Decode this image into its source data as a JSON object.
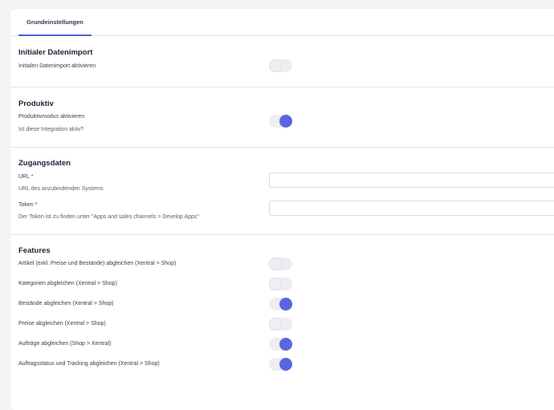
{
  "tabs": [
    {
      "label": "Grundeinstellungen",
      "active": true
    }
  ],
  "sections": {
    "initial_import": {
      "heading": "Initialer Datenimport",
      "toggle_label": "Initialen Datenimport aktivieren",
      "enabled": false
    },
    "produktiv": {
      "heading": "Produktiv",
      "toggle_label": "Produktivmodus aktivieren",
      "help": "Ist diese Integration aktiv?",
      "enabled": true
    },
    "zugangsdaten": {
      "heading": "Zugangsdaten",
      "url_label": "URL *",
      "url_help": "URL des anzubindenden Systems",
      "url_value": "",
      "token_label": "Token *",
      "token_help": "Der Token ist zu finden unter \"Apps and sales channels > Develop Apps\"",
      "token_value": ""
    },
    "features": {
      "heading": "Features",
      "items": [
        {
          "label": "Artikel (exkl. Preise und Bestände) abgleichen (Xentral > Shop)",
          "enabled": false
        },
        {
          "label": "Kategorien abgleichen (Xentral > Shop)",
          "enabled": false
        },
        {
          "label": "Bestände abgleichen (Xentral > Shop)",
          "enabled": true
        },
        {
          "label": "Preise abgleichen (Xentral > Shop)",
          "enabled": false
        },
        {
          "label": "Aufträge abgleichen (Shop > Xentral)",
          "enabled": true
        },
        {
          "label": "Auftragsstatus und Tracking abgleichen (Xentral > Shop)",
          "enabled": true
        }
      ]
    }
  },
  "colors": {
    "accent": "#5a66dd",
    "toggle_off": "#edeef2",
    "divider": "#e3e5ea"
  }
}
